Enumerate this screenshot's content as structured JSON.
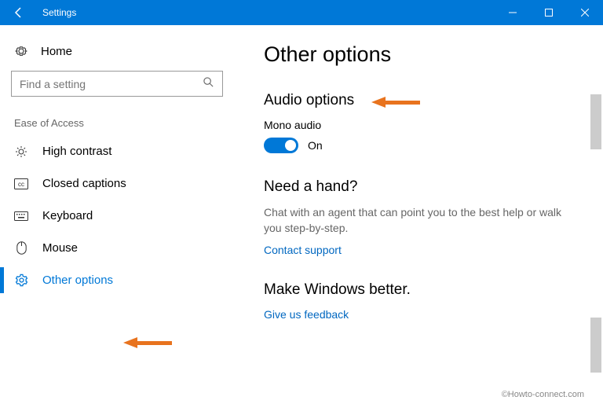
{
  "window": {
    "title": "Settings"
  },
  "sidebar": {
    "home": "Home",
    "search_placeholder": "Find a setting",
    "category": "Ease of Access",
    "items": [
      {
        "label": "High contrast"
      },
      {
        "label": "Closed captions"
      },
      {
        "label": "Keyboard"
      },
      {
        "label": "Mouse"
      },
      {
        "label": "Other options"
      }
    ]
  },
  "main": {
    "title": "Other options",
    "audio": {
      "heading": "Audio options",
      "mono_label": "Mono audio",
      "mono_state": "On"
    },
    "help": {
      "heading": "Need a hand?",
      "desc": "Chat with an agent that can point you to the best help or walk you step-by-step.",
      "link": "Contact support"
    },
    "feedback": {
      "heading": "Make Windows better.",
      "link": "Give us feedback"
    }
  },
  "watermark": "©Howto-connect.com"
}
